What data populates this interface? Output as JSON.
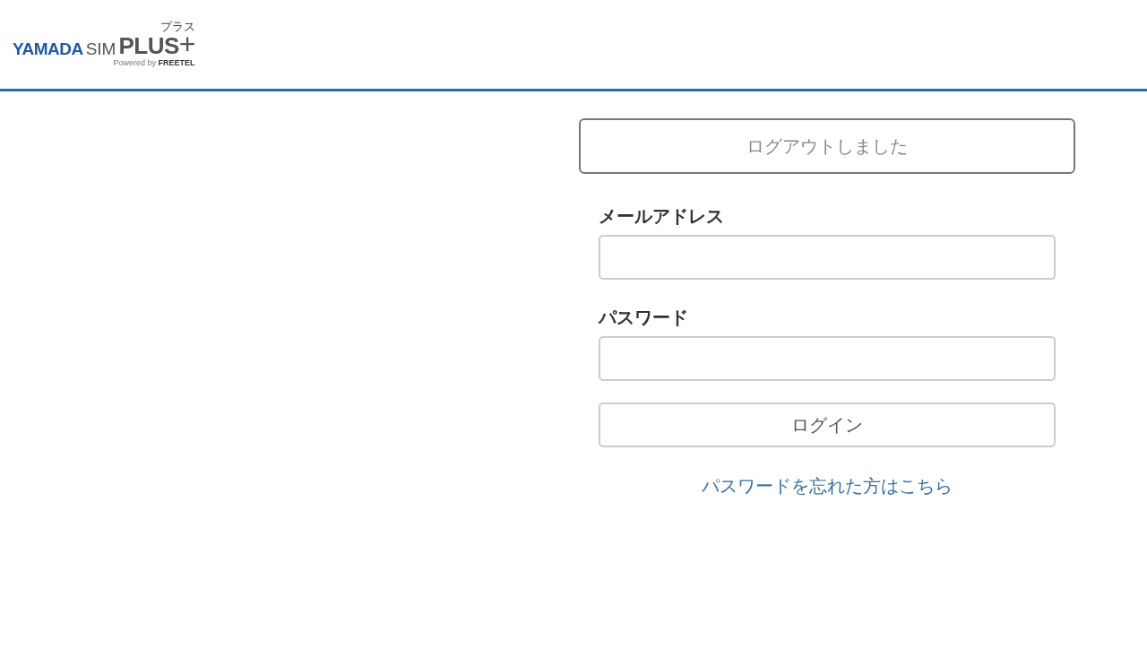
{
  "header": {
    "logo": {
      "brand": "YAMADA",
      "product": "SIM",
      "edition": "PLUS",
      "plus_sign": "+",
      "ruby": "プラス",
      "tagline": "Powered by **FREETEL**"
    }
  },
  "notice": "ログアウトしました",
  "form": {
    "fields": [
      {
        "label": "メールアドレス"
      },
      {
        "label": "パスワード"
      }
    ],
    "submit": "ログイン",
    "forgot_link": "パスワードを忘れた方はこちら"
  }
}
